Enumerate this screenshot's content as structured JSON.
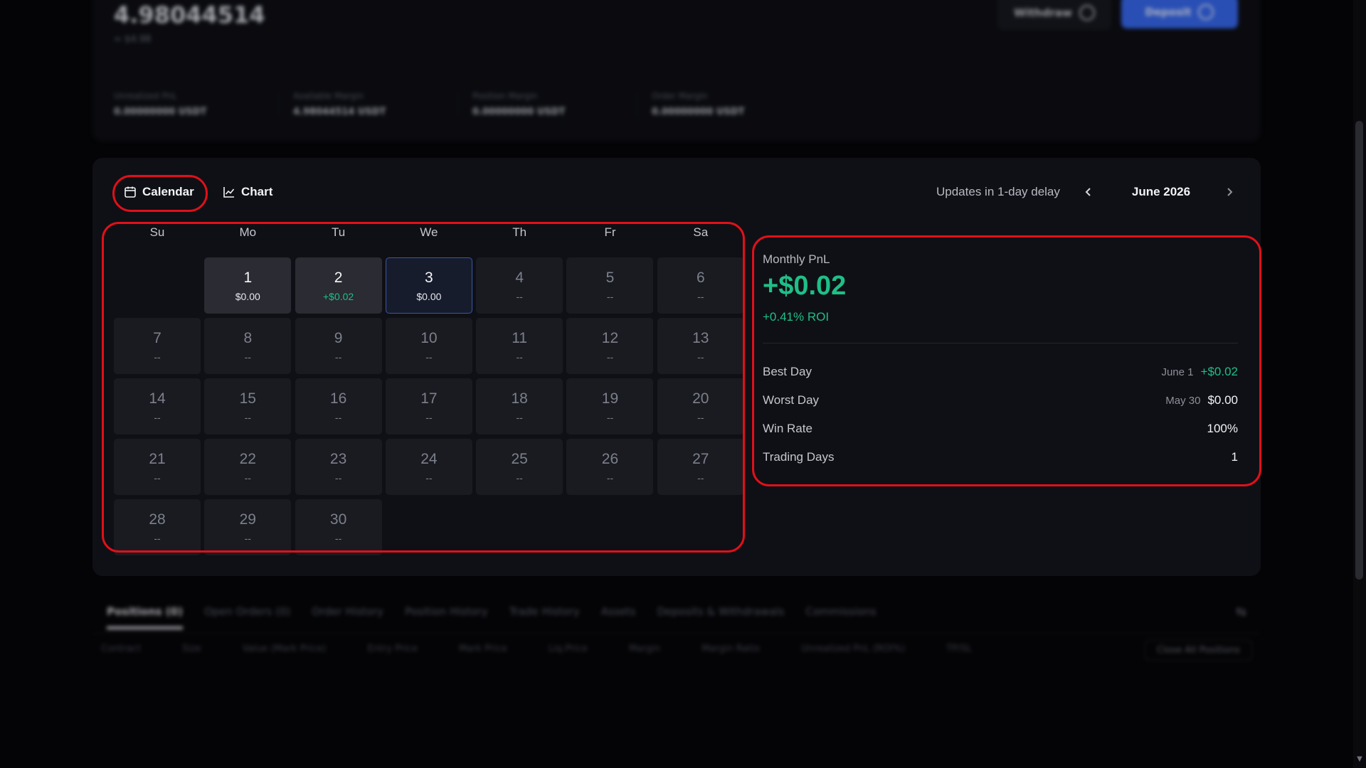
{
  "account": {
    "balance": "4.98044514",
    "balance_usd": "≈ $4.98",
    "withdraw_label": "Withdraw",
    "deposit_label": "Deposit",
    "metrics": [
      {
        "label": "Unrealized PnL",
        "value": "0.00000000 USDT"
      },
      {
        "label": "Available Margin",
        "value": "4.98044514 USDT"
      },
      {
        "label": "Position Margin",
        "value": "0.00000000 USDT"
      },
      {
        "label": "Order Margin",
        "value": "0.00000000 USDT"
      }
    ]
  },
  "pnl": {
    "tabs": {
      "calendar": "Calendar",
      "chart": "Chart"
    },
    "update_note": "Updates in 1-day delay",
    "month_label": "June 2026",
    "weekdays": [
      "Su",
      "Mo",
      "Tu",
      "We",
      "Th",
      "Fr",
      "Sa"
    ],
    "first_weekday_offset": 1,
    "days": [
      {
        "day": "1",
        "pnl": "$0.00",
        "active": true
      },
      {
        "day": "2",
        "pnl": "+$0.02",
        "active": true,
        "positive": true
      },
      {
        "day": "3",
        "pnl": "$0.00",
        "active": true,
        "today": true
      },
      {
        "day": "4",
        "pnl": "--"
      },
      {
        "day": "5",
        "pnl": "--"
      },
      {
        "day": "6",
        "pnl": "--"
      },
      {
        "day": "7",
        "pnl": "--"
      },
      {
        "day": "8",
        "pnl": "--"
      },
      {
        "day": "9",
        "pnl": "--"
      },
      {
        "day": "10",
        "pnl": "--"
      },
      {
        "day": "11",
        "pnl": "--"
      },
      {
        "day": "12",
        "pnl": "--"
      },
      {
        "day": "13",
        "pnl": "--"
      },
      {
        "day": "14",
        "pnl": "--"
      },
      {
        "day": "15",
        "pnl": "--"
      },
      {
        "day": "16",
        "pnl": "--"
      },
      {
        "day": "17",
        "pnl": "--"
      },
      {
        "day": "18",
        "pnl": "--"
      },
      {
        "day": "19",
        "pnl": "--"
      },
      {
        "day": "20",
        "pnl": "--"
      },
      {
        "day": "21",
        "pnl": "--"
      },
      {
        "day": "22",
        "pnl": "--"
      },
      {
        "day": "23",
        "pnl": "--"
      },
      {
        "day": "24",
        "pnl": "--"
      },
      {
        "day": "25",
        "pnl": "--"
      },
      {
        "day": "26",
        "pnl": "--"
      },
      {
        "day": "27",
        "pnl": "--"
      },
      {
        "day": "28",
        "pnl": "--"
      },
      {
        "day": "29",
        "pnl": "--"
      },
      {
        "day": "30",
        "pnl": "--"
      }
    ],
    "summary": {
      "title": "Monthly PnL",
      "value": "+$0.02",
      "roi": "+0.41% ROI",
      "best_day_label": "Best Day",
      "best_day_date": "June 1",
      "best_day_value": "+$0.02",
      "worst_day_label": "Worst Day",
      "worst_day_date": "May 30",
      "worst_day_value": "$0.00",
      "win_rate_label": "Win Rate",
      "win_rate_value": "100%",
      "trading_days_label": "Trading Days",
      "trading_days_value": "1"
    }
  },
  "positions": {
    "tabs": [
      "Positions (0)",
      "Open Orders (0)",
      "Order History",
      "Position History",
      "Trade History",
      "Assets",
      "Deposits & Withdrawals",
      "Commissions"
    ],
    "columns": [
      "Contract",
      "Size",
      "Value (Mark Price)",
      "Entry Price",
      "Mark Price",
      "Liq.Price",
      "Margin",
      "Margin Ratio",
      "Unrealized PnL (ROI%)",
      "TP/SL"
    ],
    "close_all_label": "Close All Positions"
  },
  "colors": {
    "profit": "#1fbf87",
    "accent": "#3668f0",
    "annotation": "#e0101a"
  }
}
